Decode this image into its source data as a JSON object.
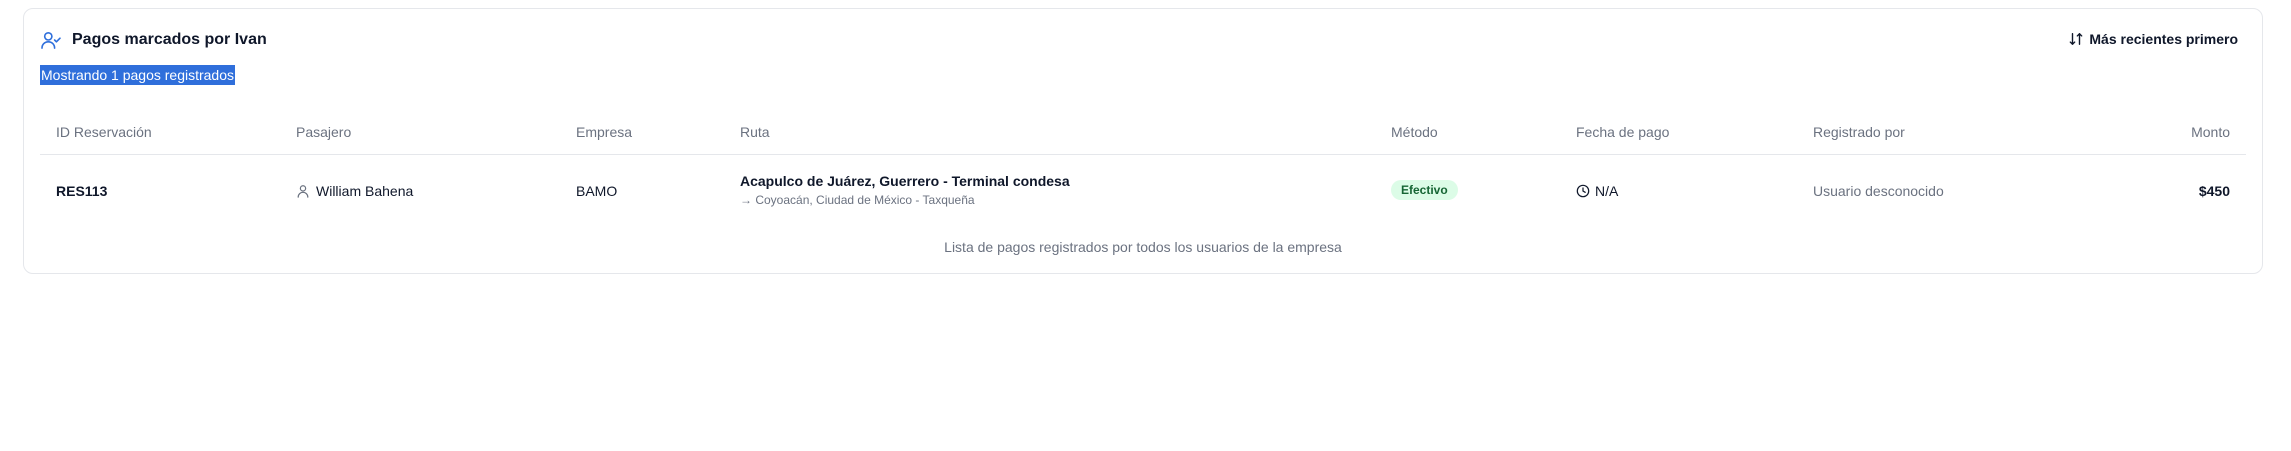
{
  "header": {
    "title": "Pagos marcados por Ivan",
    "subtitle": "Mostrando 1 pagos registrados",
    "sort_label": "Más recientes primero"
  },
  "table": {
    "columns": [
      "ID Reservación",
      "Pasajero",
      "Empresa",
      "Ruta",
      "Método",
      "Fecha de pago",
      "Registrado por",
      "Monto"
    ],
    "rows": [
      {
        "id": "RES113",
        "passenger": "William Bahena",
        "company": "BAMO",
        "route_from": "Acapulco de Juárez, Guerrero - Terminal condesa",
        "route_to": "→ Coyoacán, Ciudad de México - Taxqueña",
        "method": "Efectivo",
        "paid_at": "N/A",
        "registered_by": "Usuario desconocido",
        "amount": "$450"
      }
    ]
  },
  "footer": {
    "caption": "Lista de pagos registrados por todos los usuarios de la empresa"
  },
  "colors": {
    "accent": "#2f6fdb",
    "badge_bg": "#dcfce7",
    "badge_text": "#166534"
  }
}
